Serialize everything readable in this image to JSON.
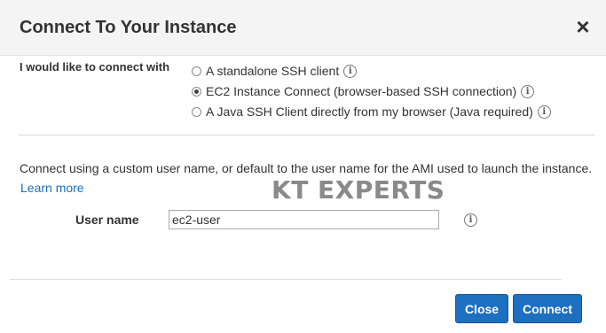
{
  "dialog": {
    "title": "Connect To Your Instance",
    "close_glyph": "×"
  },
  "connect_method": {
    "label": "I would like to connect with",
    "options": [
      {
        "label": "A standalone SSH client",
        "selected": false
      },
      {
        "label": "EC2 Instance Connect (browser-based SSH connection)",
        "selected": true
      },
      {
        "label": "A Java SSH Client directly from my browser (Java required)",
        "selected": false
      }
    ]
  },
  "description": "Connect using a custom user name, or default to the user name for the AMI used to launch the instance.",
  "learn_more": "Learn more",
  "watermark": "KT EXPERTS",
  "user_name": {
    "label": "User name",
    "value": "ec2-user"
  },
  "info_glyph": "i",
  "buttons": {
    "close": "Close",
    "connect": "Connect"
  },
  "colors": {
    "primary_button": "#1c6fc1",
    "link": "#1a6fb9",
    "header_bg": "#f4f4f4"
  }
}
